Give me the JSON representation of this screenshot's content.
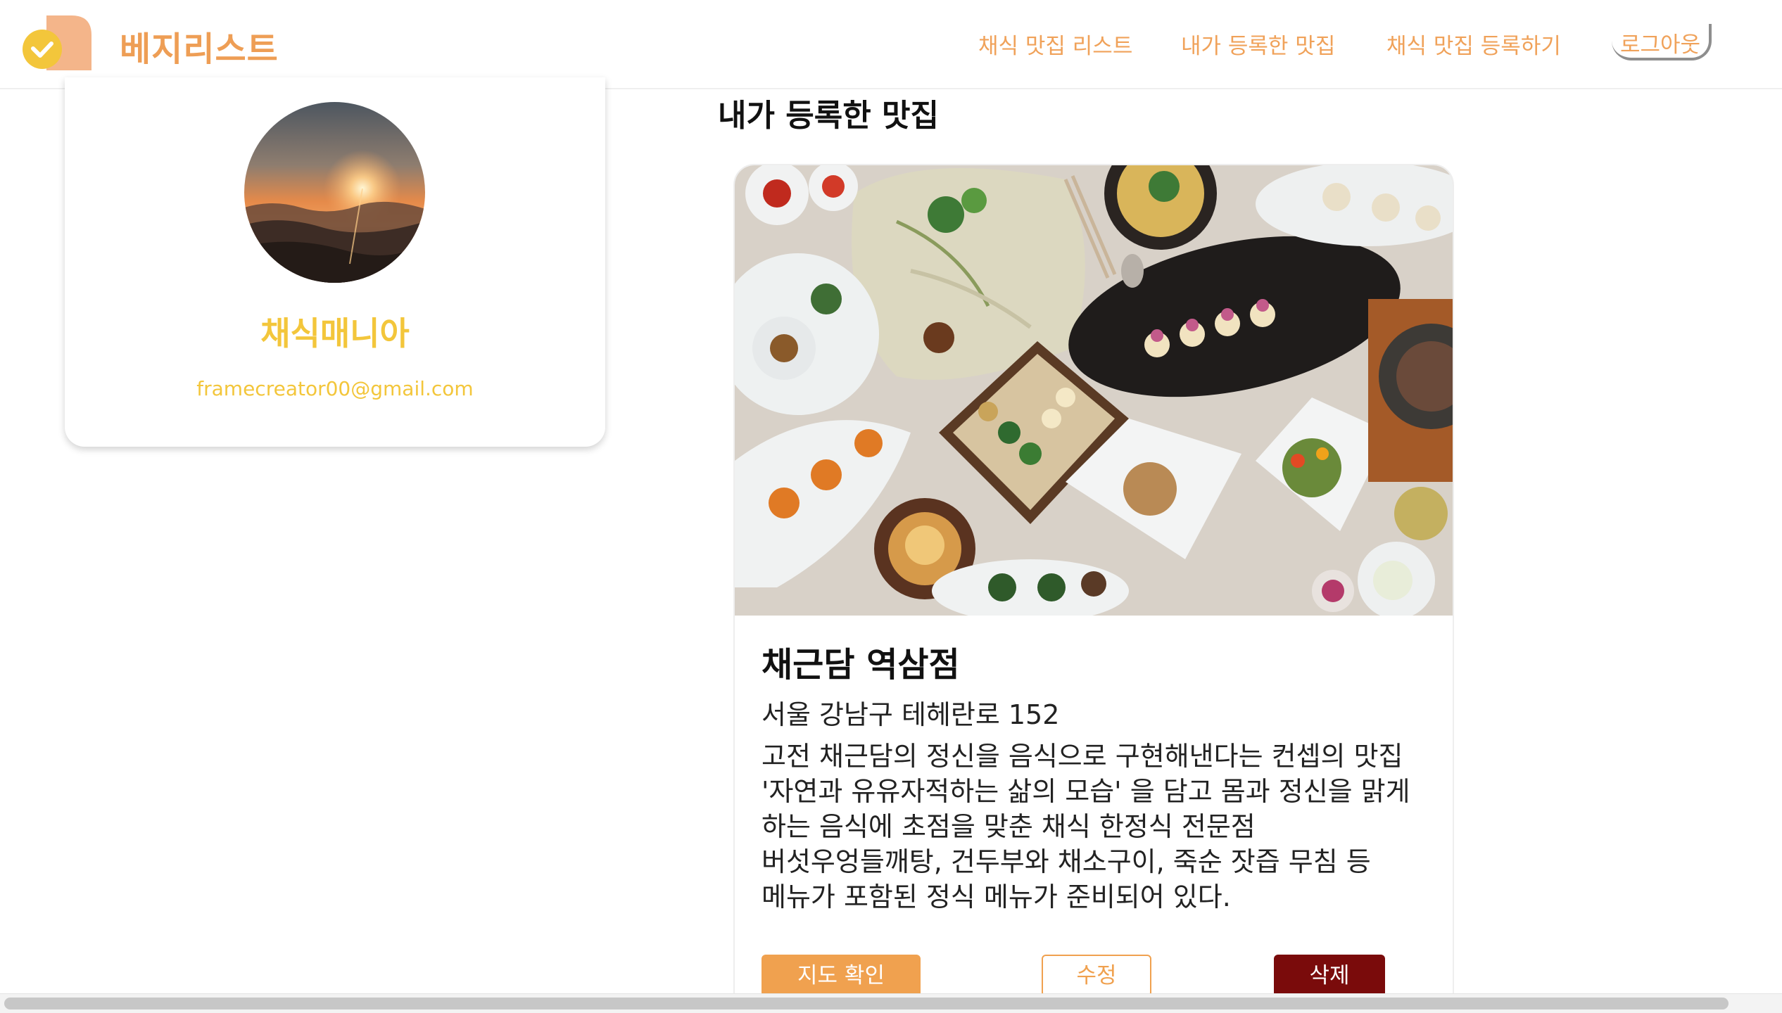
{
  "brand": {
    "title": "베지리스트",
    "logo_icon": "check-badge-icon",
    "colors": {
      "primary": "#ee9e55",
      "accent": "#f3c63b",
      "danger": "#7a0b0b"
    }
  },
  "nav": {
    "items": [
      {
        "label": "채식 맛집 리스트"
      },
      {
        "label": "내가 등록한 맛집"
      },
      {
        "label": "채식 맛집 등록하기"
      }
    ],
    "logout_label": "로그아웃"
  },
  "profile": {
    "avatar": "sunrise-mountain-photo",
    "name": "채식매니아",
    "email": "framecreator00@gmail.com"
  },
  "main": {
    "title": "내가 등록한 맛집",
    "restaurant": {
      "photo": "korean-vegetarian-course-photo",
      "name": "채근담 역삼점",
      "address": "서울 강남구 테헤란로 152",
      "description": "고전 채근담의 정신을 음식으로 구현해낸다는 컨셉의 맛집 '자연과 유유자적하는 삶의 모습' 을 담고 몸과 정신을 맑게 하는 음식에 초점을 맞춘 채식 한정식 전문점 버섯우엉들깨탕, 건두부와 채소구이, 죽순 잣즙 무침 등 메뉴가 포함된 정식 메뉴가 준비되어 있다.",
      "buttons": {
        "map_label": "지도 확인",
        "edit_label": "수정",
        "delete_label": "삭제"
      }
    }
  }
}
